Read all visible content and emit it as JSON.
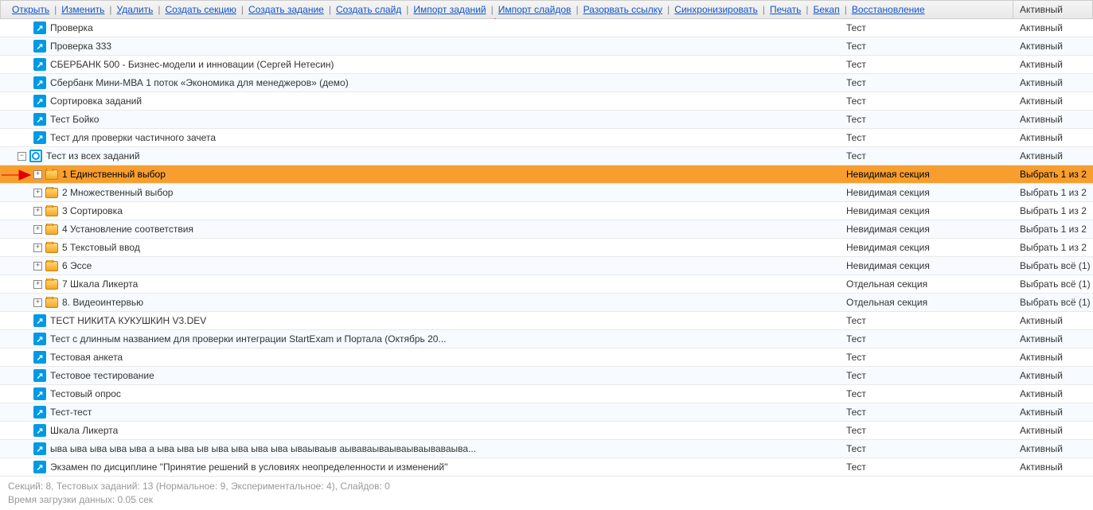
{
  "toolbar": {
    "links": [
      "Открыть",
      "Изменить",
      "Удалить",
      "Создать секцию",
      "Создать задание",
      "Создать слайд",
      "Импорт заданий",
      "Импорт слайдов",
      "Разорвать ссылку",
      "Синхронизировать",
      "Печать",
      "Бекап",
      "Восстановление"
    ],
    "status_header": "Активный"
  },
  "rows": [
    {
      "indent": 2,
      "icon": "test",
      "name": "Проверка",
      "type": "Тест",
      "status": "Активный"
    },
    {
      "indent": 2,
      "icon": "test",
      "name": "Проверка 333",
      "type": "Тест",
      "status": "Активный"
    },
    {
      "indent": 2,
      "icon": "test",
      "name": "СБЕРБАНК 500 - Бизнес-модели и инновации (Сергей Нетесин)",
      "type": "Тест",
      "status": "Активный"
    },
    {
      "indent": 2,
      "icon": "test",
      "name": "Сбербанк Мини-МВА 1 поток «Экономика для менеджеров» (демо)",
      "type": "Тест",
      "status": "Активный"
    },
    {
      "indent": 2,
      "icon": "test",
      "name": "Сортировка заданий",
      "type": "Тест",
      "status": "Активный"
    },
    {
      "indent": 2,
      "icon": "test",
      "name": "Тест Бойко",
      "type": "Тест",
      "status": "Активный"
    },
    {
      "indent": 2,
      "icon": "test",
      "name": "Тест для проверки частичного зачета",
      "type": "Тест",
      "status": "Активный"
    },
    {
      "indent": 1,
      "expander": "minus",
      "icon": "test-ring",
      "name": "Тест из всех заданий",
      "type": "Тест",
      "status": "Активный"
    },
    {
      "indent": 2,
      "expander": "plus",
      "icon": "folder",
      "name": "1 Единственный выбор",
      "type": "Невидимая секция",
      "status": "Выбрать 1 из 2",
      "selected": true,
      "arrow": true
    },
    {
      "indent": 2,
      "expander": "plus",
      "icon": "folder",
      "name": "2 Множественный выбор",
      "type": "Невидимая секция",
      "status": "Выбрать 1 из 2"
    },
    {
      "indent": 2,
      "expander": "plus",
      "icon": "folder",
      "name": "3 Сортировка",
      "type": "Невидимая секция",
      "status": "Выбрать 1 из 2"
    },
    {
      "indent": 2,
      "expander": "plus",
      "icon": "folder",
      "name": "4 Установление соответствия",
      "type": "Невидимая секция",
      "status": "Выбрать 1 из 2"
    },
    {
      "indent": 2,
      "expander": "plus",
      "icon": "folder",
      "name": "5 Текстовый ввод",
      "type": "Невидимая секция",
      "status": "Выбрать 1 из 2"
    },
    {
      "indent": 2,
      "expander": "plus",
      "icon": "folder",
      "name": "6 Эссе",
      "type": "Невидимая секция",
      "status": "Выбрать всё (1)"
    },
    {
      "indent": 2,
      "expander": "plus",
      "icon": "folder",
      "name": "7 Шкала Ликерта",
      "type": "Отдельная секция",
      "status": "Выбрать всё (1)"
    },
    {
      "indent": 2,
      "expander": "plus",
      "icon": "folder",
      "name": "8. Видеоинтервью",
      "type": "Отдельная секция",
      "status": "Выбрать всё (1)"
    },
    {
      "indent": 2,
      "icon": "test",
      "name": "ТЕСТ НИКИТА КУКУШКИН V3.DEV",
      "type": "Тест",
      "status": "Активный"
    },
    {
      "indent": 2,
      "icon": "test",
      "name": "Тест с длинным названием для проверки интеграции StartExam и Портала (Октябрь 20...",
      "type": "Тест",
      "status": "Активный"
    },
    {
      "indent": 2,
      "icon": "test",
      "name": "Тестовая анкета",
      "type": "Тест",
      "status": "Активный"
    },
    {
      "indent": 2,
      "icon": "test",
      "name": "Тестовое тестирование",
      "type": "Тест",
      "status": "Активный"
    },
    {
      "indent": 2,
      "icon": "test",
      "name": "Тестовый опрос",
      "type": "Тест",
      "status": "Активный"
    },
    {
      "indent": 2,
      "icon": "test",
      "name": "Тест-тест",
      "type": "Тест",
      "status": "Активный"
    },
    {
      "indent": 2,
      "icon": "test",
      "name": "Шкала Ликерта",
      "type": "Тест",
      "status": "Активный"
    },
    {
      "indent": 2,
      "icon": "test",
      "name": "ыва ыва ыва ыва ыва а ыва ыва ыв ыва ыва ыва ыва ываываыв аываваываываываываваыва...",
      "type": "Тест",
      "status": "Активный"
    },
    {
      "indent": 2,
      "icon": "test",
      "name": "Экзамен по дисциплине \"Принятие решений в условиях неопределенности и изменений\"",
      "type": "Тест",
      "status": "Активный"
    }
  ],
  "footer": {
    "line1": "Секций: 8, Тестовых заданий: 13 (Нормальное: 9, Экспериментальное: 4), Слайдов: 0",
    "line2": "Время загрузки данных: 0.05 сек"
  }
}
